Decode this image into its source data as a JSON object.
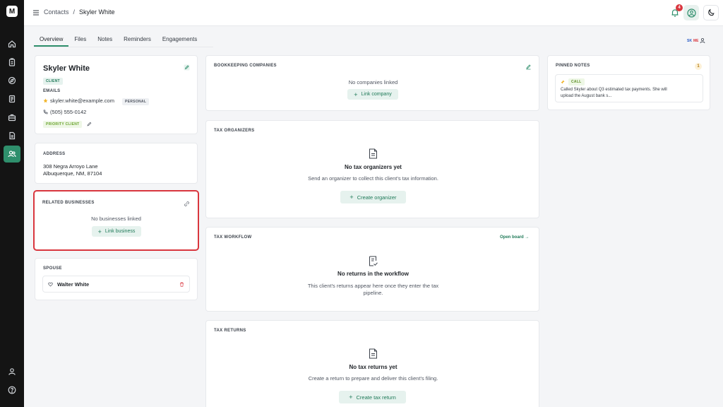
{
  "nav": {
    "logo_letter": "M",
    "icons": [
      "home-icon",
      "clipboard-icon",
      "compass-icon",
      "document-list-icon",
      "briefcase-icon",
      "file-icon",
      "contacts-icon"
    ],
    "bottom_icons": [
      "user-icon",
      "help-icon"
    ]
  },
  "header": {
    "breadcrumb_root": "Contacts",
    "breadcrumb_sep": "/",
    "breadcrumb_current": "Skyler White",
    "notification_count": "4"
  },
  "tabs": [
    "Overview",
    "Files",
    "Notes",
    "Reminders",
    "Engagements"
  ],
  "presence": {
    "a": "SK",
    "b": "ME"
  },
  "contact": {
    "name": "Skyler White",
    "type_badge": "CLIENT",
    "emails_label": "EMAILS",
    "email": "skyler.white@example.com",
    "email_badge": "PERSONAL",
    "phone": "(505) 555-0142",
    "tag": "PRIORITY CLIENT"
  },
  "address": {
    "label": "ADDRESS",
    "line1": "308 Negra Arroyo Lane",
    "line2": "Albuquerque, NM, 87104"
  },
  "related": {
    "label": "RELATED BUSINESSES",
    "empty": "No businesses linked",
    "button": "Link business"
  },
  "spouse": {
    "label": "SPOUSE",
    "name": "Walter White"
  },
  "bookkeeping": {
    "label": "BOOKKEEPING COMPANIES",
    "empty": "No companies linked",
    "button": "Link company"
  },
  "organizers": {
    "label": "TAX ORGANIZERS",
    "empty_title": "No tax organizers yet",
    "empty_desc": "Send an organizer to collect this client's tax information.",
    "button": "Create organizer"
  },
  "workflow": {
    "label": "TAX WORKFLOW",
    "link": "Open board →",
    "empty_title": "No returns in the workflow",
    "empty_desc_1": "This client's returns appear here once they enter the tax",
    "empty_desc_2": "pipeline."
  },
  "returns": {
    "label": "TAX RETURNS",
    "empty_title": "No tax returns yet",
    "empty_desc": "Create a return to prepare and deliver this client's filing.",
    "button": "Create tax return"
  },
  "pinned": {
    "label": "PINNED NOTES",
    "count": "1",
    "note_type": "CALL",
    "note_text_1": "Called Skyler about Q3 estimated tax payments. She will",
    "note_text_2": "upload the August bank s..."
  },
  "colors": {
    "accent": "#2f8f6c",
    "highlight_border": "#d9363e",
    "sidebar": "#141414"
  }
}
